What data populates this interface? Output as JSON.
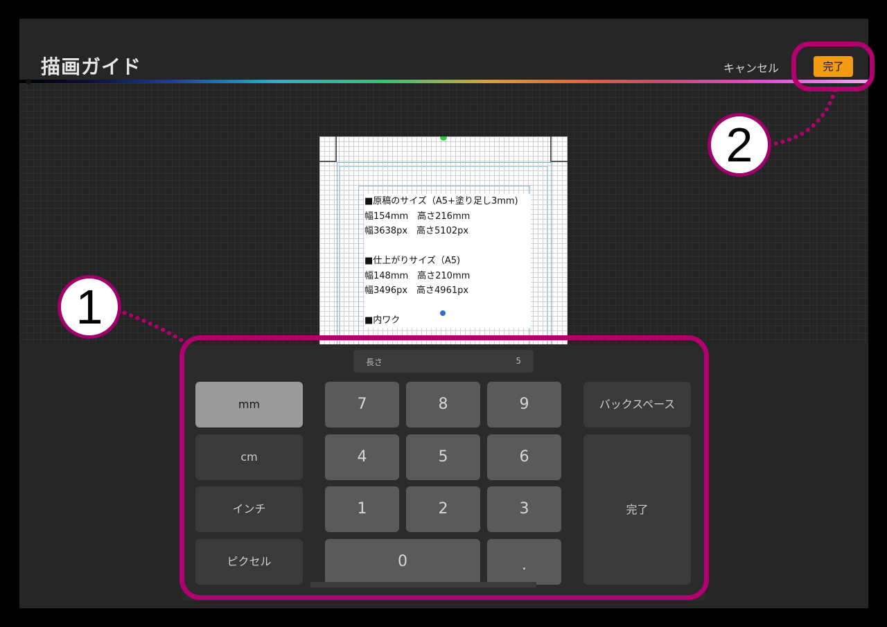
{
  "header": {
    "title": "描画ガイド",
    "cancel_label": "キャンセル",
    "done_label": "完了"
  },
  "canvas": {
    "info_lines": [
      "■原稿のサイズ（A5+塗り足し3mm)",
      "幅154mm　高さ216mm",
      "幅3638px　高さ5102px",
      "",
      "■仕上がりサイズ（A5)",
      "幅148mm　高さ210mm",
      "幅3496px　高さ4961px",
      "",
      "■内ワク"
    ]
  },
  "keypad": {
    "field_label": "長さ",
    "field_value": "5",
    "units": [
      "mm",
      "cm",
      "インチ",
      "ピクセル"
    ],
    "selected_unit": "mm",
    "digits": [
      "7",
      "8",
      "9",
      "4",
      "5",
      "6",
      "1",
      "2",
      "3",
      "0",
      "."
    ],
    "backspace_label": "バックスペース",
    "done_label": "完了"
  },
  "annotations": {
    "marker1": "1",
    "marker2": "2",
    "highlight_color": "#b1006e"
  },
  "colors": {
    "accent": "#f39c12",
    "annotation": "#b1006e"
  }
}
